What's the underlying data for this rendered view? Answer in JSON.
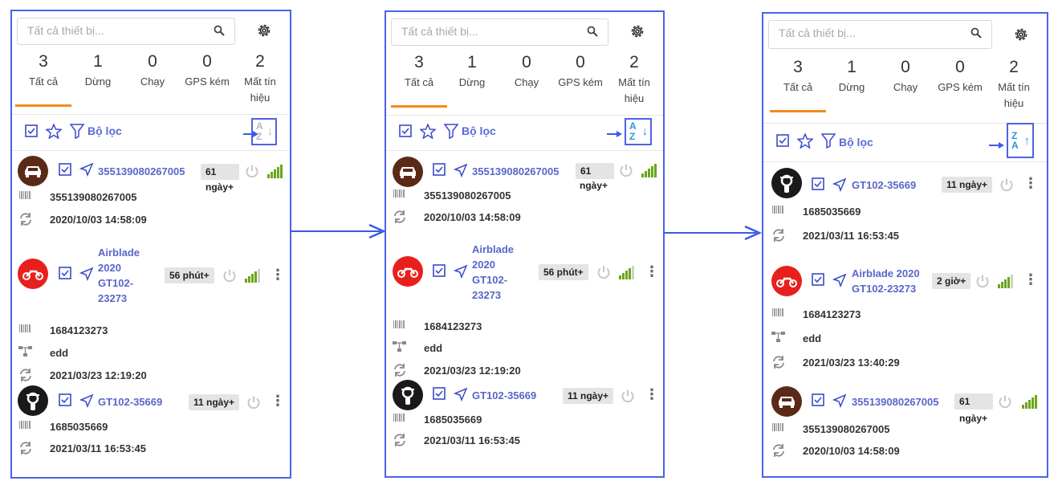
{
  "search_placeholder": "Tất cả thiết bị...",
  "tabs": [
    {
      "count": "3",
      "label": "Tất cả"
    },
    {
      "count": "1",
      "label": "Dừng"
    },
    {
      "count": "0",
      "label": "Chạy"
    },
    {
      "count": "0",
      "label": "GPS kém"
    },
    {
      "count": "2",
      "label": "Mất tín",
      "label2": "hiệu"
    }
  ],
  "filter_label": "Bộ lọc",
  "sort": {
    "ascending": {
      "top": "A",
      "bottom": "Z",
      "arrow": "↓"
    },
    "descending": {
      "top": "Z",
      "bottom": "A",
      "arrow": "↑"
    }
  },
  "colors": {
    "accent": "#f08c1f",
    "highlight": "#4a63e6",
    "name": "#5866c8",
    "signal_green": "#6aa61c"
  },
  "panels": [
    {
      "vehicles": [
        {
          "type": "car",
          "avatar_color": "#5b2a17",
          "name_lines": [
            "355139080267005"
          ],
          "badge": "61",
          "badge_tail": "ngày+",
          "imei": "355139080267005",
          "time": "2020/10/03 14:58:09",
          "signal_bars": 5
        },
        {
          "type": "moto",
          "avatar_color": "#e8201d",
          "name_lines": [
            "Airblade",
            "2020",
            "GT102-",
            "23273"
          ],
          "badge": "56 phút+",
          "badge_tail": "",
          "imei": "1684123273",
          "group": "edd",
          "time": "2021/03/23 12:19:20",
          "signal_bars": 4
        },
        {
          "type": "scooter",
          "avatar_color": "#1a1a1a",
          "name_lines": [
            "GT102-35669"
          ],
          "badge": "11 ngày+",
          "badge_tail": "",
          "imei": "1685035669",
          "time": "2021/03/11 16:53:45",
          "signal_bars": 0
        }
      ]
    },
    {
      "vehicles": [
        {
          "type": "car",
          "avatar_color": "#5b2a17",
          "name_lines": [
            "355139080267005"
          ],
          "badge": "61",
          "badge_tail": "ngày+",
          "imei": "355139080267005",
          "time": "2020/10/03 14:58:09",
          "signal_bars": 5
        },
        {
          "type": "moto",
          "avatar_color": "#e8201d",
          "name_lines": [
            "Airblade",
            "2020",
            "GT102-",
            "23273"
          ],
          "badge": "56 phút+",
          "badge_tail": "",
          "imei": "1684123273",
          "group": "edd",
          "time": "2021/03/23 12:19:20",
          "signal_bars": 4
        },
        {
          "type": "scooter",
          "avatar_color": "#1a1a1a",
          "name_lines": [
            "GT102-35669"
          ],
          "badge": "11 ngày+",
          "badge_tail": "",
          "imei": "1685035669",
          "time": "2021/03/11 16:53:45",
          "signal_bars": 0
        }
      ]
    },
    {
      "vehicles": [
        {
          "type": "scooter",
          "avatar_color": "#1a1a1a",
          "name_lines": [
            "GT102-35669"
          ],
          "badge": "11 ngày+",
          "badge_tail": "",
          "imei": "1685035669",
          "time": "2021/03/11 16:53:45",
          "signal_bars": 0
        },
        {
          "type": "moto",
          "avatar_color": "#e8201d",
          "name_lines": [
            "Airblade 2020",
            "GT102-23273"
          ],
          "badge": "2 giờ+",
          "badge_tail": "",
          "imei": "1684123273",
          "group": "edd",
          "time": "2021/03/23 13:40:29",
          "signal_bars": 4
        },
        {
          "type": "car",
          "avatar_color": "#5b2a17",
          "name_lines": [
            "355139080267005"
          ],
          "badge": "61",
          "badge_tail": "ngày+",
          "imei": "355139080267005",
          "time": "2020/10/03 14:58:09",
          "signal_bars": 5
        }
      ]
    }
  ]
}
